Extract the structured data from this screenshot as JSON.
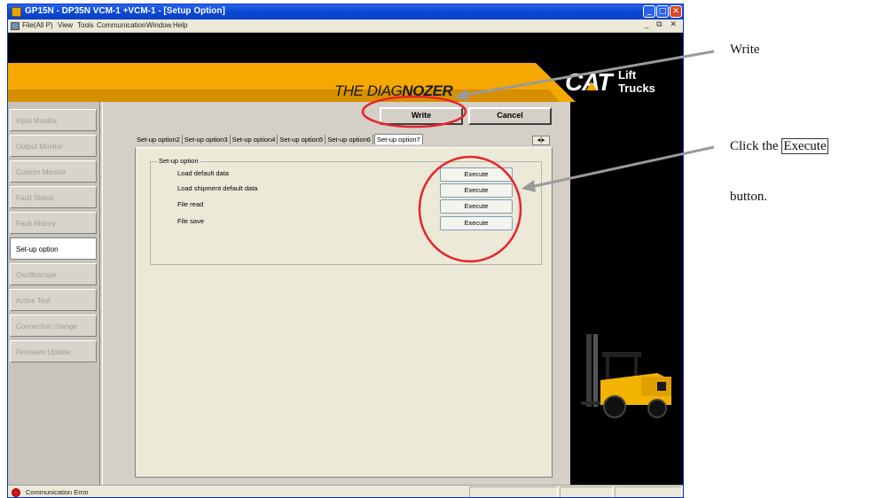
{
  "window": {
    "title": "GP15N - DP35N VCM-1 +VCM-1 - [Setup Option]",
    "controls": [
      "_",
      "□",
      "✕"
    ]
  },
  "menubar": {
    "items": [
      "File(All P)",
      "View",
      "Tools",
      "Communication",
      "Window",
      "Help"
    ],
    "mdi_controls": "_ ⧉ ✕"
  },
  "banner": {
    "title_prefix": "THE DIAG",
    "title_bold": "NOZER",
    "brand": "CAT",
    "brand_sub": [
      "Lift",
      "Trucks"
    ],
    "colors": {
      "orange": "#f5a800",
      "black": "#000000"
    }
  },
  "nav": {
    "items": [
      {
        "label": "Input Monitor",
        "active": false
      },
      {
        "label": "Output Monitor",
        "active": false
      },
      {
        "label": "Custom Monitor",
        "active": false
      },
      {
        "label": "Fault Status",
        "active": false
      },
      {
        "label": "Fault History",
        "active": false
      },
      {
        "label": "Set-up option",
        "active": true
      },
      {
        "label": "Oscilloscope",
        "active": false
      },
      {
        "label": "Active Test",
        "active": false
      },
      {
        "label": "Connection change",
        "active": false
      },
      {
        "label": "Firmware Update",
        "active": false
      }
    ]
  },
  "actions": {
    "write": "Write",
    "cancel": "Cancel"
  },
  "tabs": {
    "items": [
      "Set-up option2",
      "Set-up option3",
      "Set-up option4",
      "Set-up option5",
      "Set-up option6",
      "Set-up option7"
    ],
    "active_index": 5,
    "scroll_arrows": "◂|▸"
  },
  "setup": {
    "group_title": "Set-up option",
    "rows": [
      {
        "label": "Load default data",
        "button": "Execute"
      },
      {
        "label": "Load shipment default data",
        "button": "Execute"
      },
      {
        "label": "File read",
        "button": "Execute"
      },
      {
        "label": "File save",
        "button": "Execute"
      }
    ]
  },
  "status": {
    "text": "Communication Error"
  },
  "annotations": {
    "write": "Write",
    "click_prefix": "Click the ",
    "click_key": "Execute",
    "click_suffix": "button.",
    "color": "#e8232a",
    "arrow_color": "#9a9a9a"
  }
}
